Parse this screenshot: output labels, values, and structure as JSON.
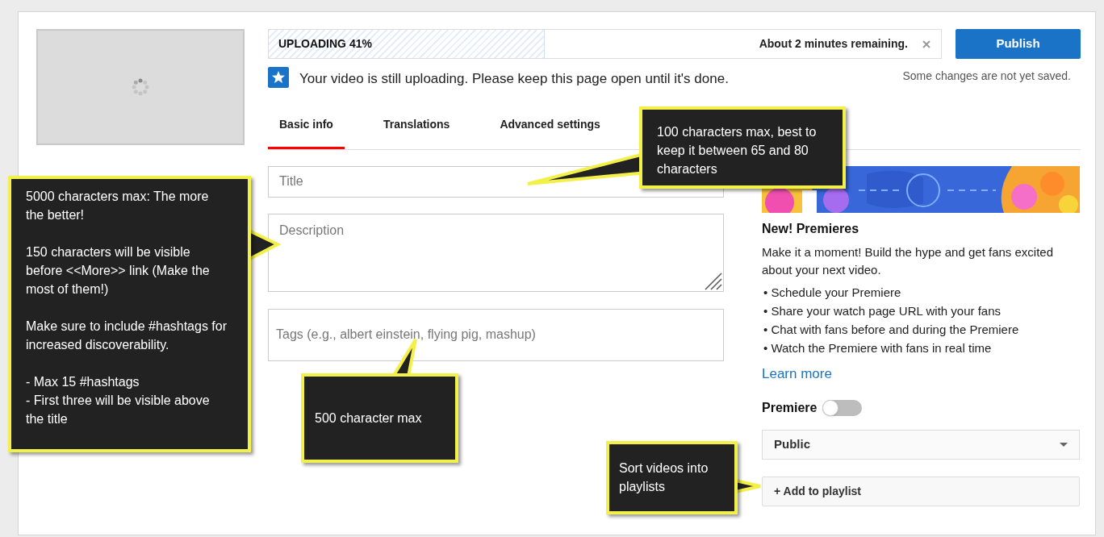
{
  "upload": {
    "status": "UPLOADING 41%",
    "level": 0.41,
    "remaining": "About 2 minutes remaining."
  },
  "notice": "Your video is still uploading. Please keep this page open until it's done.",
  "publish": {
    "label": "Publish",
    "note": "Some changes are not yet saved."
  },
  "tabs": [
    {
      "label": "Basic info",
      "selected": true
    },
    {
      "label": "Translations",
      "selected": false
    },
    {
      "label": "Advanced settings",
      "selected": false
    }
  ],
  "fields": [
    {
      "kind": "input",
      "placeholder": "Title"
    },
    {
      "kind": "textarea",
      "placeholder": "Description"
    },
    {
      "kind": "tall-input",
      "placeholder": "Tags (e.g., albert einstein, flying pig, mashup)"
    }
  ],
  "premieres": {
    "title": "New! Premieres",
    "text": "Make it a moment! Build the hype and get fans excited about your next video.",
    "bullets": [
      "• Schedule your Premiere",
      "• Share your watch page URL with your fans",
      "• Chat with fans before and during the Premiere",
      "• Watch the Premiere with fans in real time"
    ],
    "link": "Learn more",
    "toggle": {
      "label": "Premiere",
      "on": false
    }
  },
  "visibility": {
    "value": "Public"
  },
  "playlist_button": "+ Add to playlist",
  "callouts": [
    {
      "text": "100 characters max, best to keep it between 65 and 80 characters"
    },
    {
      "text": "5000 characters max: The more the better!\n\n150 characters will be visible before <<More>> link (Make the most of them!)\n\nMake sure to include #hashtags for increased discoverability.\n\n- Max 15 #hashtags\n- First three will be visible above the title"
    },
    {
      "text": "500 character max"
    },
    {
      "text": "Sort videos into playlists"
    }
  ]
}
